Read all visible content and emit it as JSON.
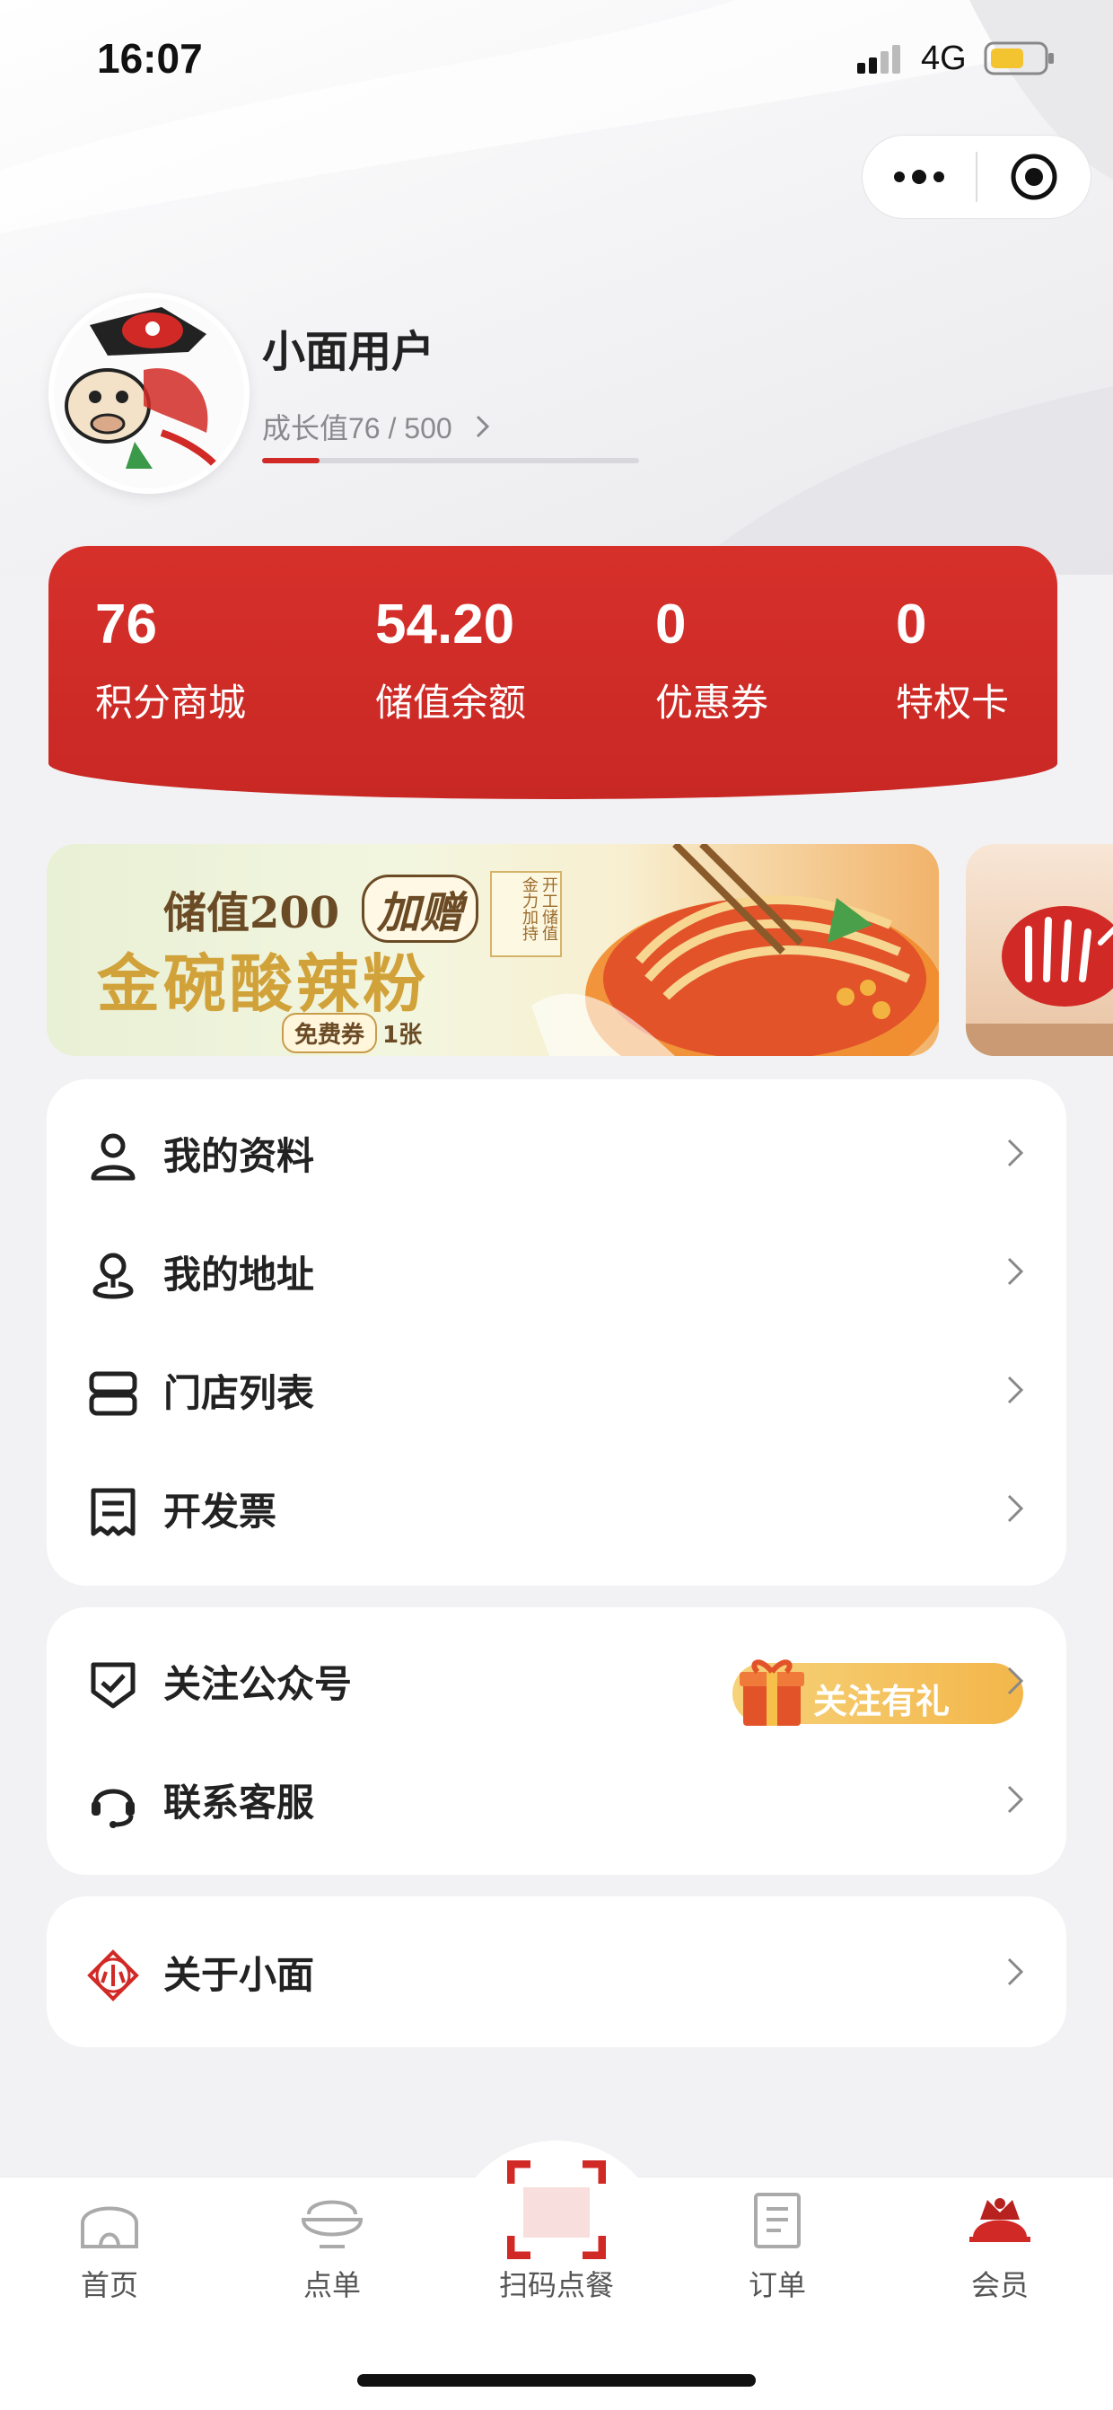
{
  "status_bar": {
    "time": "16:07",
    "network": "4G"
  },
  "profile": {
    "username": "小面用户",
    "growth_label": "成长值76 / 500",
    "growth_progress": 0.152
  },
  "stats": [
    {
      "value": "76",
      "label": "积分商城"
    },
    {
      "value": "54.20",
      "label": "储值余额"
    },
    {
      "value": "0",
      "label": "优惠券"
    },
    {
      "value": "0",
      "label": "特权卡"
    }
  ],
  "banner": {
    "line1": "储值200",
    "line1_tag": "加赠",
    "line2": "金碗酸辣粉",
    "coupon_tag": "免费券",
    "coupon_count": "1张",
    "side_text": "开工储值 金力加持"
  },
  "menu_group1": [
    {
      "label": "我的资料",
      "icon": "user-icon"
    },
    {
      "label": "我的地址",
      "icon": "location-icon"
    },
    {
      "label": "门店列表",
      "icon": "store-icon"
    },
    {
      "label": "开发票",
      "icon": "invoice-icon"
    }
  ],
  "menu_group2": [
    {
      "label": "关注公众号",
      "icon": "follow-icon",
      "badge": "关注有礼"
    },
    {
      "label": "联系客服",
      "icon": "support-icon"
    }
  ],
  "menu_group3": [
    {
      "label": "关于小面",
      "icon": "brand-logo-icon"
    }
  ],
  "tabs": [
    {
      "label": "首页",
      "icon": "home-icon"
    },
    {
      "label": "点单",
      "icon": "bowl-icon"
    },
    {
      "label": "扫码点餐",
      "icon": "scan-icon"
    },
    {
      "label": "订单",
      "icon": "order-icon"
    },
    {
      "label": "会员",
      "icon": "member-icon"
    }
  ],
  "colors": {
    "brand_red": "#d12a26",
    "card_red": "#c82824",
    "badge_gold": "#f3b64a"
  }
}
